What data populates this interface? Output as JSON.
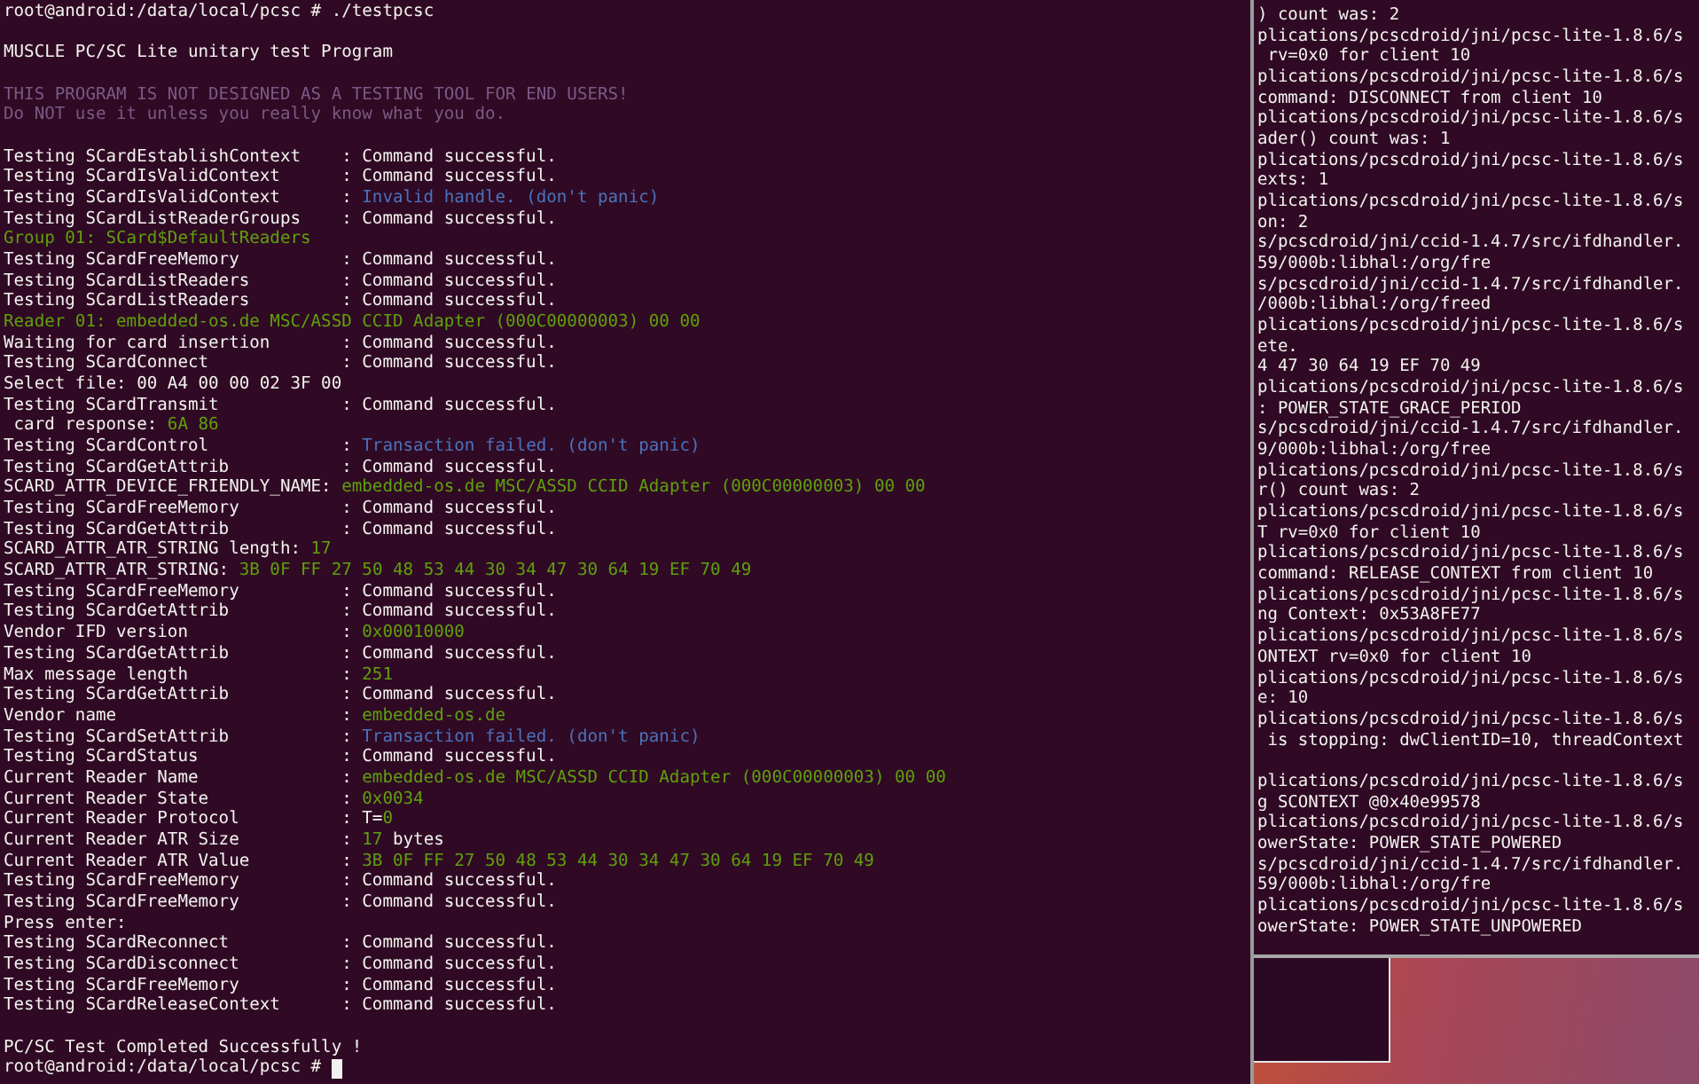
{
  "main_terminal": {
    "lines": [
      {
        "kind": "text",
        "segments": [
          {
            "text": "root@android:/data/local/pcsc # ./testpcsc",
            "kind": "normal"
          }
        ]
      },
      {
        "kind": "blank"
      },
      {
        "kind": "text",
        "segments": [
          {
            "text": "MUSCLE PC/SC Lite unitary test Program",
            "kind": "normal"
          }
        ]
      },
      {
        "kind": "blank"
      },
      {
        "kind": "text",
        "segments": [
          {
            "text": "THIS PROGRAM IS NOT DESIGNED AS A TESTING TOOL FOR END USERS!",
            "kind": "purple"
          }
        ]
      },
      {
        "kind": "text",
        "segments": [
          {
            "text": "Do NOT use it unless you really know what you do.",
            "kind": "purple"
          }
        ]
      },
      {
        "kind": "blank"
      },
      {
        "kind": "field",
        "label": "Testing SCardEstablishContext",
        "value": [
          {
            "text": ": Command successful.",
            "kind": "normal"
          }
        ]
      },
      {
        "kind": "field",
        "label": "Testing SCardIsValidContext",
        "value": [
          {
            "text": ": Command successful.",
            "kind": "normal"
          }
        ]
      },
      {
        "kind": "field",
        "label": "Testing SCardIsValidContext",
        "value": [
          {
            "text": ": ",
            "kind": "normal"
          },
          {
            "text": "Invalid handle. (don't panic)",
            "kind": "blue"
          }
        ]
      },
      {
        "kind": "field",
        "label": "Testing SCardListReaderGroups",
        "value": [
          {
            "text": ": Command successful.",
            "kind": "normal"
          }
        ]
      },
      {
        "kind": "text",
        "segments": [
          {
            "text": "Group 01: SCard$DefaultReaders",
            "kind": "green"
          }
        ]
      },
      {
        "kind": "field",
        "label": "Testing SCardFreeMemory",
        "value": [
          {
            "text": ": Command successful.",
            "kind": "normal"
          }
        ]
      },
      {
        "kind": "field",
        "label": "Testing SCardListReaders",
        "value": [
          {
            "text": ": Command successful.",
            "kind": "normal"
          }
        ]
      },
      {
        "kind": "field",
        "label": "Testing SCardListReaders",
        "value": [
          {
            "text": ": Command successful.",
            "kind": "normal"
          }
        ]
      },
      {
        "kind": "text",
        "segments": [
          {
            "text": "Reader 01: embedded-os.de MSC/ASSD CCID Adapter (000C00000003) 00 00",
            "kind": "green"
          }
        ]
      },
      {
        "kind": "field",
        "label": "Waiting for card insertion",
        "value": [
          {
            "text": ": Command successful.",
            "kind": "normal"
          }
        ]
      },
      {
        "kind": "field",
        "label": "Testing SCardConnect",
        "value": [
          {
            "text": ": Command successful.",
            "kind": "normal"
          }
        ]
      },
      {
        "kind": "text",
        "segments": [
          {
            "text": "Select file: 00 A4 00 00 02 3F 00",
            "kind": "normal"
          }
        ]
      },
      {
        "kind": "field",
        "label": "Testing SCardTransmit",
        "value": [
          {
            "text": ": Command successful.",
            "kind": "normal"
          }
        ]
      },
      {
        "kind": "text",
        "segments": [
          {
            "text": " card response: ",
            "kind": "normal"
          },
          {
            "text": "6A 86",
            "kind": "green"
          }
        ]
      },
      {
        "kind": "field",
        "label": "Testing SCardControl",
        "value": [
          {
            "text": ": ",
            "kind": "normal"
          },
          {
            "text": "Transaction failed. (don't panic)",
            "kind": "blue"
          }
        ]
      },
      {
        "kind": "field",
        "label": "Testing SCardGetAttrib",
        "value": [
          {
            "text": ": Command successful.",
            "kind": "normal"
          }
        ]
      },
      {
        "kind": "text",
        "segments": [
          {
            "text": "SCARD_ATTR_DEVICE_FRIENDLY_NAME: ",
            "kind": "normal"
          },
          {
            "text": "embedded-os.de MSC/ASSD CCID Adapter (000C00000003) 00 00",
            "kind": "green"
          }
        ]
      },
      {
        "kind": "field",
        "label": "Testing SCardFreeMemory",
        "value": [
          {
            "text": ": Command successful.",
            "kind": "normal"
          }
        ]
      },
      {
        "kind": "field",
        "label": "Testing SCardGetAttrib",
        "value": [
          {
            "text": ": Command successful.",
            "kind": "normal"
          }
        ]
      },
      {
        "kind": "text",
        "segments": [
          {
            "text": "SCARD_ATTR_ATR_STRING length: ",
            "kind": "normal"
          },
          {
            "text": "17",
            "kind": "green"
          }
        ]
      },
      {
        "kind": "text",
        "segments": [
          {
            "text": "SCARD_ATTR_ATR_STRING: ",
            "kind": "normal"
          },
          {
            "text": "3B 0F FF 27 50 48 53 44 30 34 47 30 64 19 EF 70 49",
            "kind": "green"
          }
        ]
      },
      {
        "kind": "field",
        "label": "Testing SCardFreeMemory",
        "value": [
          {
            "text": ": Command successful.",
            "kind": "normal"
          }
        ]
      },
      {
        "kind": "field",
        "label": "Testing SCardGetAttrib",
        "value": [
          {
            "text": ": Command successful.",
            "kind": "normal"
          }
        ]
      },
      {
        "kind": "field",
        "label": "Vendor IFD version",
        "value": [
          {
            "text": ": ",
            "kind": "normal"
          },
          {
            "text": "0x00010000",
            "kind": "green"
          }
        ]
      },
      {
        "kind": "field",
        "label": "Testing SCardGetAttrib",
        "value": [
          {
            "text": ": Command successful.",
            "kind": "normal"
          }
        ]
      },
      {
        "kind": "field",
        "label": "Max message length",
        "value": [
          {
            "text": ": ",
            "kind": "normal"
          },
          {
            "text": "251",
            "kind": "green"
          }
        ]
      },
      {
        "kind": "field",
        "label": "Testing SCardGetAttrib",
        "value": [
          {
            "text": ": Command successful.",
            "kind": "normal"
          }
        ]
      },
      {
        "kind": "field",
        "label": "Vendor name",
        "value": [
          {
            "text": ": ",
            "kind": "normal"
          },
          {
            "text": "embedded-os.de",
            "kind": "green"
          }
        ]
      },
      {
        "kind": "field",
        "label": "Testing SCardSetAttrib",
        "value": [
          {
            "text": ": ",
            "kind": "normal"
          },
          {
            "text": "Transaction failed. (don't panic)",
            "kind": "blue"
          }
        ]
      },
      {
        "kind": "field",
        "label": "Testing SCardStatus",
        "value": [
          {
            "text": ": Command successful.",
            "kind": "normal"
          }
        ]
      },
      {
        "kind": "field",
        "label": "Current Reader Name",
        "value": [
          {
            "text": ": ",
            "kind": "normal"
          },
          {
            "text": "embedded-os.de MSC/ASSD CCID Adapter (000C00000003) 00 00",
            "kind": "green"
          }
        ]
      },
      {
        "kind": "field",
        "label": "Current Reader State",
        "value": [
          {
            "text": ": ",
            "kind": "normal"
          },
          {
            "text": "0x0034",
            "kind": "green"
          }
        ]
      },
      {
        "kind": "field",
        "label": "Current Reader Protocol",
        "value": [
          {
            "text": ": T=",
            "kind": "normal"
          },
          {
            "text": "0",
            "kind": "green"
          }
        ]
      },
      {
        "kind": "field",
        "label": "Current Reader ATR Size",
        "value": [
          {
            "text": ": ",
            "kind": "normal"
          },
          {
            "text": "17",
            "kind": "green"
          },
          {
            "text": " bytes",
            "kind": "normal"
          }
        ]
      },
      {
        "kind": "field",
        "label": "Current Reader ATR Value",
        "value": [
          {
            "text": ": ",
            "kind": "normal"
          },
          {
            "text": "3B 0F FF 27 50 48 53 44 30 34 47 30 64 19 EF 70 49",
            "kind": "green"
          }
        ]
      },
      {
        "kind": "field",
        "label": "Testing SCardFreeMemory",
        "value": [
          {
            "text": ": Command successful.",
            "kind": "normal"
          }
        ]
      },
      {
        "kind": "field",
        "label": "Testing SCardFreeMemory",
        "value": [
          {
            "text": ": Command successful.",
            "kind": "normal"
          }
        ]
      },
      {
        "kind": "text",
        "segments": [
          {
            "text": "Press enter:",
            "kind": "normal"
          }
        ]
      },
      {
        "kind": "field",
        "label": "Testing SCardReconnect",
        "value": [
          {
            "text": ": Command successful.",
            "kind": "normal"
          }
        ]
      },
      {
        "kind": "field",
        "label": "Testing SCardDisconnect",
        "value": [
          {
            "text": ": Command successful.",
            "kind": "normal"
          }
        ]
      },
      {
        "kind": "field",
        "label": "Testing SCardFreeMemory",
        "value": [
          {
            "text": ": Command successful.",
            "kind": "normal"
          }
        ]
      },
      {
        "kind": "field",
        "label": "Testing SCardReleaseContext",
        "value": [
          {
            "text": ": Command successful.",
            "kind": "normal"
          }
        ]
      },
      {
        "kind": "blank"
      },
      {
        "kind": "text",
        "segments": [
          {
            "text": "PC/SC Test Completed Successfully !",
            "kind": "normal"
          }
        ]
      },
      {
        "kind": "prompt",
        "segments": [
          {
            "text": "root@android:/data/local/pcsc # ",
            "kind": "normal"
          }
        ]
      }
    ]
  },
  "log_terminal": {
    "lines": [
      {
        "kind": "text",
        "text": ") count was: 2"
      },
      {
        "kind": "text",
        "text": "plications/pcscdroid/jni/pcsc-lite-1.8.6/s"
      },
      {
        "kind": "text",
        "text": " rv=0x0 for client 10"
      },
      {
        "kind": "text",
        "text": "plications/pcscdroid/jni/pcsc-lite-1.8.6/s"
      },
      {
        "kind": "text",
        "text": "command: DISCONNECT from client 10"
      },
      {
        "kind": "text",
        "text": "plications/pcscdroid/jni/pcsc-lite-1.8.6/s"
      },
      {
        "kind": "text",
        "text": "ader() count was: 1"
      },
      {
        "kind": "text",
        "text": "plications/pcscdroid/jni/pcsc-lite-1.8.6/s"
      },
      {
        "kind": "text",
        "text": "exts: 1"
      },
      {
        "kind": "text",
        "text": "plications/pcscdroid/jni/pcsc-lite-1.8.6/s"
      },
      {
        "kind": "text",
        "text": "on: 2"
      },
      {
        "kind": "text",
        "text": "s/pcscdroid/jni/ccid-1.4.7/src/ifdhandler."
      },
      {
        "kind": "text",
        "text": "59/000b:libhal:/org/fre"
      },
      {
        "kind": "text",
        "text": "s/pcscdroid/jni/ccid-1.4.7/src/ifdhandler."
      },
      {
        "kind": "text",
        "text": "/000b:libhal:/org/freed"
      },
      {
        "kind": "text",
        "text": "plications/pcscdroid/jni/pcsc-lite-1.8.6/s"
      },
      {
        "kind": "text",
        "text": "ete."
      },
      {
        "kind": "text",
        "text": "4 47 30 64 19 EF 70 49"
      },
      {
        "kind": "text",
        "text": "plications/pcscdroid/jni/pcsc-lite-1.8.6/s"
      },
      {
        "kind": "text",
        "text": ": POWER_STATE_GRACE_PERIOD"
      },
      {
        "kind": "text",
        "text": "s/pcscdroid/jni/ccid-1.4.7/src/ifdhandler."
      },
      {
        "kind": "text",
        "text": "9/000b:libhal:/org/free"
      },
      {
        "kind": "text",
        "text": "plications/pcscdroid/jni/pcsc-lite-1.8.6/s"
      },
      {
        "kind": "text",
        "text": "r() count was: 2"
      },
      {
        "kind": "text",
        "text": "plications/pcscdroid/jni/pcsc-lite-1.8.6/s"
      },
      {
        "kind": "text",
        "text": "T rv=0x0 for client 10"
      },
      {
        "kind": "text",
        "text": "plications/pcscdroid/jni/pcsc-lite-1.8.6/s"
      },
      {
        "kind": "text",
        "text": "command: RELEASE_CONTEXT from client 10"
      },
      {
        "kind": "text",
        "text": "plications/pcscdroid/jni/pcsc-lite-1.8.6/s"
      },
      {
        "kind": "text",
        "text": "ng Context: 0x53A8FE77"
      },
      {
        "kind": "text",
        "text": "plications/pcscdroid/jni/pcsc-lite-1.8.6/s"
      },
      {
        "kind": "text",
        "text": "ONTEXT rv=0x0 for client 10"
      },
      {
        "kind": "text",
        "text": "plications/pcscdroid/jni/pcsc-lite-1.8.6/s"
      },
      {
        "kind": "text",
        "text": "e: 10"
      },
      {
        "kind": "text",
        "text": "plications/pcscdroid/jni/pcsc-lite-1.8.6/s"
      },
      {
        "kind": "text",
        "text": " is stopping: dwClientID=10, threadContext"
      },
      {
        "kind": "blank"
      },
      {
        "kind": "text",
        "text": "plications/pcscdroid/jni/pcsc-lite-1.8.6/s"
      },
      {
        "kind": "text",
        "text": "g SCONTEXT @0x40e99578"
      },
      {
        "kind": "text",
        "text": "plications/pcscdroid/jni/pcsc-lite-1.8.6/s"
      },
      {
        "kind": "text",
        "text": "owerState: POWER_STATE_POWERED"
      },
      {
        "kind": "text",
        "text": "s/pcscdroid/jni/ccid-1.4.7/src/ifdhandler."
      },
      {
        "kind": "text",
        "text": "59/000b:libhal:/org/fre"
      },
      {
        "kind": "text",
        "text": "plications/pcscdroid/jni/pcsc-lite-1.8.6/s"
      },
      {
        "kind": "text",
        "text": "owerState: POWER_STATE_UNPOWERED"
      }
    ]
  }
}
